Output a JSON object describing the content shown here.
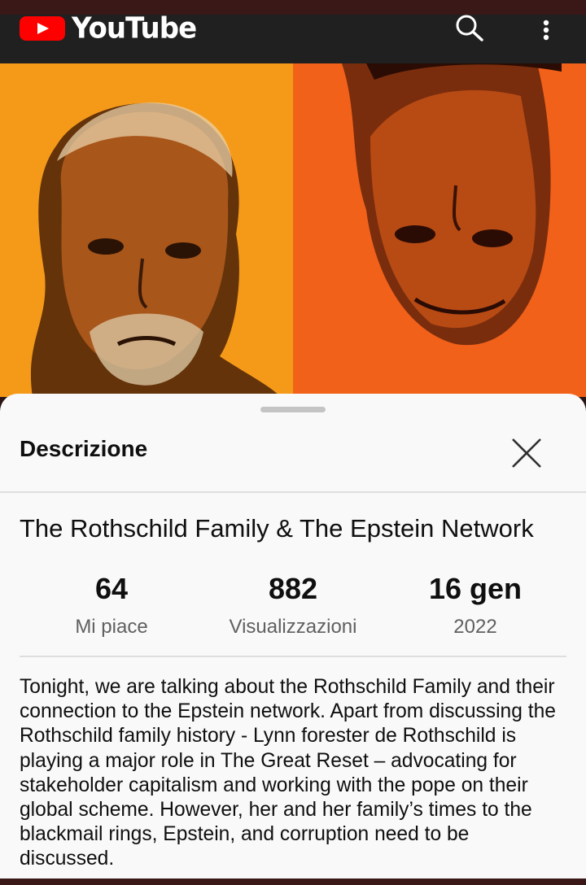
{
  "app": {
    "brand": "YouTube",
    "brand_color": "#ff0000",
    "bar_color": "#202020"
  },
  "header": {
    "icons": [
      "youtube-logo-icon",
      "search-icon",
      "more-vert-icon"
    ]
  },
  "thumbnail": {
    "colors": {
      "left": "#f59a18",
      "right": "#f2611a"
    }
  },
  "sheet": {
    "title": "Descrizione",
    "close_icon": "close-icon",
    "video_title": "The Rothschild Family & The Epstein Network",
    "stats": [
      {
        "value": "64",
        "label": "Mi piace"
      },
      {
        "value": "882",
        "label": "Visualizzazioni"
      },
      {
        "value": "16 gen",
        "label": "2022"
      }
    ],
    "description": "Tonight, we are talking about the Rothschild Family and their connection to the Epstein network. Apart from discussing the Rothschild family history - Lynn forester de Rothschild is playing a major role in The Great Reset – advocating for stakeholder capitalism and working with the pope on their global scheme. However, her and her family’s times to the blackmail rings, Epstein, and corruption need to be discussed."
  }
}
